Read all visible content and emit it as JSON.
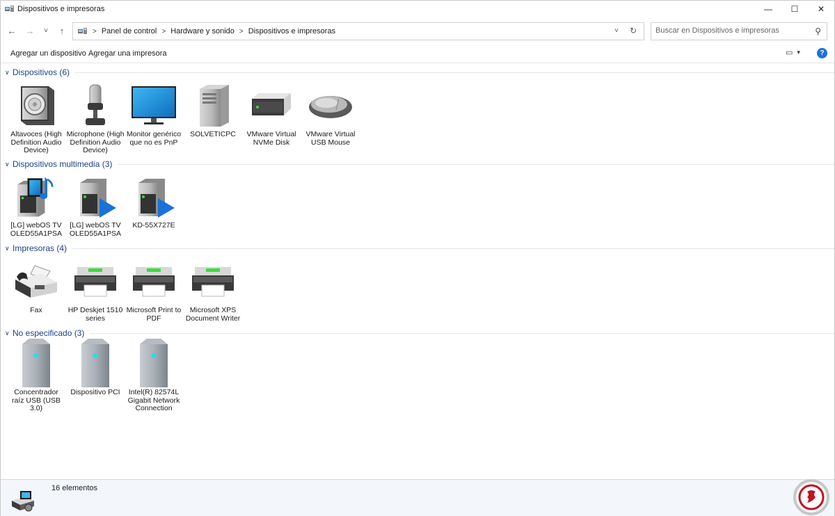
{
  "window": {
    "title": "Dispositivos e impresoras",
    "controls": {
      "minimize": "—",
      "maximize": "☐",
      "close": "✕"
    }
  },
  "nav": {
    "back": "←",
    "forward": "→",
    "recent": "˅",
    "up": "↑",
    "breadcrumbs": [
      "Panel de control",
      "Hardware y sonido",
      "Dispositivos e impresoras"
    ],
    "separator": ">",
    "dropdown": "˅",
    "refresh": "↻"
  },
  "search": {
    "placeholder": "Buscar en Dispositivos e impresoras",
    "icon_glyph": "⚲"
  },
  "toolbar": {
    "add_device": "Agregar un dispositivo",
    "add_printer": "Agregar una impresora",
    "view_glyph": "▭",
    "view_caret": "▾",
    "help_glyph": "?"
  },
  "groups": [
    {
      "title": "Dispositivos (6)",
      "items": [
        {
          "label": "Altavoces (High Definition Audio Device)",
          "icon": "speaker-icon"
        },
        {
          "label": "Microphone (High Definition Audio Device)",
          "icon": "microphone-icon"
        },
        {
          "label": "Monitor genérico que no es PnP",
          "icon": "monitor-icon"
        },
        {
          "label": "SOLVETICPC",
          "icon": "computer-tower-icon"
        },
        {
          "label": "VMware Virtual NVMe Disk",
          "icon": "disk-drive-icon"
        },
        {
          "label": "VMware Virtual USB Mouse",
          "icon": "mouse-icon"
        }
      ]
    },
    {
      "title": "Dispositivos multimedia (3)",
      "items": [
        {
          "label": "[LG] webOS TV OLED55A1PSA",
          "icon": "media-server-icon"
        },
        {
          "label": "[LG] webOS TV OLED55A1PSA",
          "icon": "media-renderer-icon"
        },
        {
          "label": "KD-55X727E",
          "icon": "media-renderer-icon"
        }
      ]
    },
    {
      "title": "Impresoras (4)",
      "items": [
        {
          "label": "Fax",
          "icon": "fax-icon"
        },
        {
          "label": "HP Deskjet 1510 series",
          "icon": "printer-icon"
        },
        {
          "label": "Microsoft Print to PDF",
          "icon": "printer-icon"
        },
        {
          "label": "Microsoft XPS Document Writer",
          "icon": "printer-icon"
        }
      ]
    },
    {
      "title": "No especificado (3)",
      "items": [
        {
          "label": "Concentrador raíz USB (USB 3.0)",
          "icon": "generic-device-icon"
        },
        {
          "label": "Dispositivo PCI",
          "icon": "generic-device-icon"
        },
        {
          "label": "Intel(R) 82574L Gigabit Network Connection",
          "icon": "generic-device-icon"
        }
      ]
    }
  ],
  "status": {
    "count": "16 elementos"
  },
  "colors": {
    "group_title": "#1e3f8c",
    "accent_blue": "#1a73d9",
    "status_bg": "#f3f6fb"
  }
}
